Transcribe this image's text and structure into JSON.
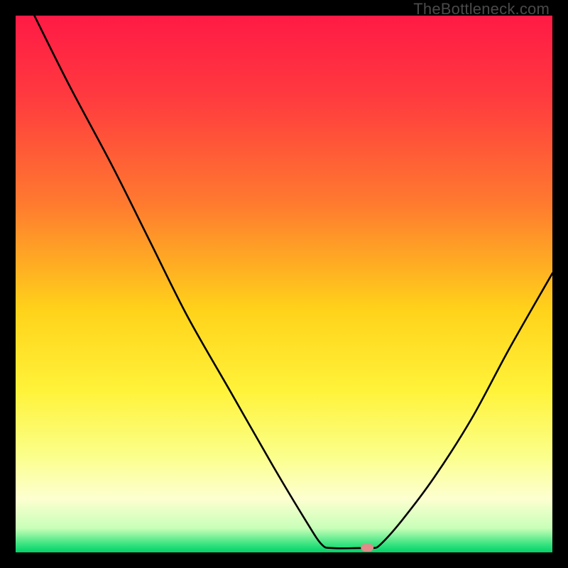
{
  "watermark": "TheBottleneck.com",
  "chart_data": {
    "type": "line",
    "title": "",
    "xlabel": "",
    "ylabel": "",
    "xlim": [
      0,
      100
    ],
    "ylim": [
      0,
      100
    ],
    "gradient_stops": [
      {
        "offset": 0.0,
        "color": "#ff1a45"
      },
      {
        "offset": 0.15,
        "color": "#ff3a3f"
      },
      {
        "offset": 0.35,
        "color": "#ff7a2f"
      },
      {
        "offset": 0.55,
        "color": "#ffd31a"
      },
      {
        "offset": 0.7,
        "color": "#fff33a"
      },
      {
        "offset": 0.82,
        "color": "#fbff8a"
      },
      {
        "offset": 0.9,
        "color": "#fdffd0"
      },
      {
        "offset": 0.955,
        "color": "#c8ffb8"
      },
      {
        "offset": 0.985,
        "color": "#38e37f"
      },
      {
        "offset": 1.0,
        "color": "#00d26a"
      }
    ],
    "series": [
      {
        "name": "bottleneck-curve",
        "points": [
          {
            "x": 3.5,
            "y": 100.0
          },
          {
            "x": 10.0,
            "y": 87.0
          },
          {
            "x": 18.0,
            "y": 72.0
          },
          {
            "x": 25.0,
            "y": 58.0
          },
          {
            "x": 32.0,
            "y": 44.0
          },
          {
            "x": 40.0,
            "y": 30.0
          },
          {
            "x": 48.0,
            "y": 16.0
          },
          {
            "x": 54.0,
            "y": 6.0
          },
          {
            "x": 57.0,
            "y": 1.5
          },
          {
            "x": 59.0,
            "y": 0.8
          },
          {
            "x": 64.0,
            "y": 0.8
          },
          {
            "x": 66.5,
            "y": 0.8
          },
          {
            "x": 68.0,
            "y": 1.5
          },
          {
            "x": 72.0,
            "y": 6.0
          },
          {
            "x": 78.0,
            "y": 14.0
          },
          {
            "x": 85.0,
            "y": 25.0
          },
          {
            "x": 92.0,
            "y": 38.0
          },
          {
            "x": 100.0,
            "y": 52.0
          }
        ]
      }
    ],
    "marker": {
      "x": 65.5,
      "y": 0.9,
      "color": "#e48a8a"
    }
  }
}
